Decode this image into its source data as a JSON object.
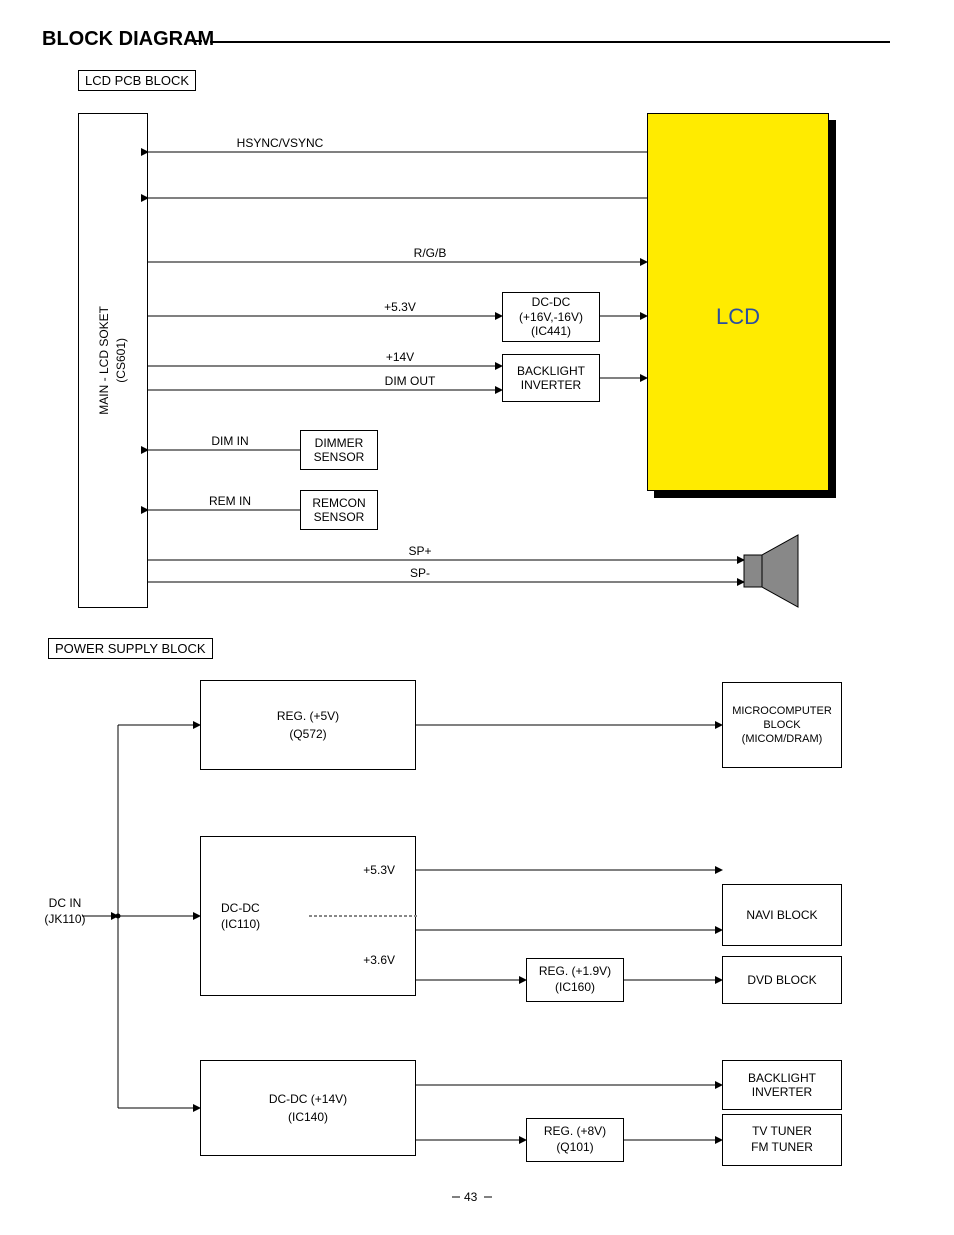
{
  "title": "BLOCK DIAGRAM",
  "lcd_block_label": "LCD PCB BLOCK",
  "soket_label_1": "MAIN - LCD SOKET",
  "soket_label_2": "(CS601)",
  "signals": {
    "hsync": "HSYNC/VSYNC",
    "rgb": "R/G/B",
    "v53": "+5.3V",
    "v14": "+14V",
    "dimout": "DIM OUT",
    "dimin": "DIM IN",
    "remin": "REM IN",
    "spp": "SP+",
    "spm": "SP-"
  },
  "blocks": {
    "dcdc_ic441_1": "DC-DC",
    "dcdc_ic441_2": "(+16V,-16V)",
    "dcdc_ic441_3": "(IC441)",
    "backlight_inv_1": "BACKLIGHT",
    "backlight_inv_2": "INVERTER",
    "dimmer_1": "DIMMER",
    "dimmer_2": "SENSOR",
    "remcon_1": "REMCON",
    "remcon_2": "SENSOR",
    "lcd": "LCD"
  },
  "power_block_label": "POWER SUPPLY BLOCK",
  "power": {
    "dcin_1": "DC IN",
    "dcin_2": "(JK110)",
    "reg5_1": "REG. (+5V)",
    "reg5_2": "(Q572)",
    "micom_1": "MICROCOMPUTER",
    "micom_2": "BLOCK",
    "micom_3": "(MICOM/DRAM)",
    "dcdc_ic110_1": "DC-DC",
    "dcdc_ic110_2": "(IC110)",
    "v53": "+5.3V",
    "v36": "+3.6V",
    "reg19_1": "REG. (+1.9V)",
    "reg19_2": "(IC160)",
    "navi": "NAVI BLOCK",
    "dvd": "DVD BLOCK",
    "dcdc14_1": "DC-DC (+14V)",
    "dcdc14_2": "(IC140)",
    "reg8_1": "REG. (+8V)",
    "reg8_2": "(Q101)",
    "bl_inv_1": "BACKLIGHT",
    "bl_inv_2": "INVERTER",
    "tv_1": "TV TUNER",
    "tv_2": "FM TUNER"
  },
  "page_no": "43"
}
